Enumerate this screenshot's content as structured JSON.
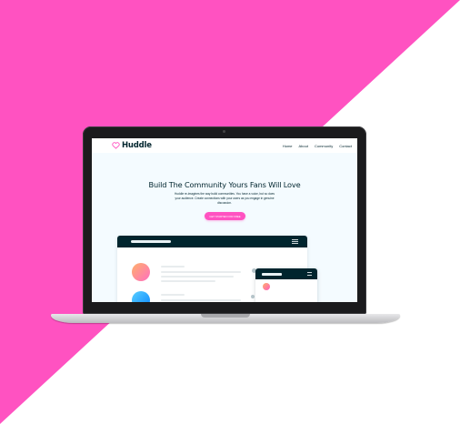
{
  "colors": {
    "background_pink": "#ff52c1",
    "background_white": "#ffffff",
    "brand_dark": "#00252e",
    "accent_pink": "#ff52c1"
  },
  "site": {
    "logo": {
      "icon": "heart-chat-icon",
      "text": "Huddle"
    },
    "nav": [
      "Home",
      "About",
      "Community",
      "Contact"
    ],
    "hero": {
      "title": "Build The Community Yours Fans Will Love",
      "text": "Huddle re-imagines the way build communities. You have a voice, but so does your audience. Create connections with your users as you engage in genuine discussion.",
      "cta": "GET STARTED FOR FREE"
    }
  }
}
